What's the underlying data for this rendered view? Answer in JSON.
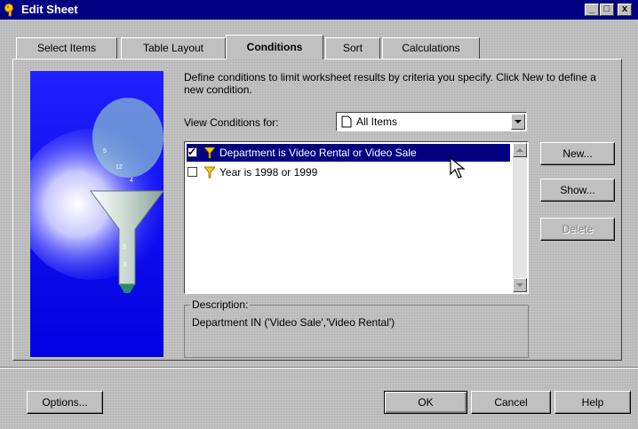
{
  "window": {
    "title": "Edit Sheet",
    "minimize": "_",
    "maximize": "□",
    "close": "x"
  },
  "tabs": [
    {
      "label": "Select Items"
    },
    {
      "label": "Table Layout"
    },
    {
      "label": "Conditions"
    },
    {
      "label": "Sort"
    },
    {
      "label": "Calculations"
    }
  ],
  "conditions": {
    "description": "Define conditions to limit worksheet results by criteria you specify. Click New to define a new condition.",
    "view_for_label": "View Conditions for:",
    "view_for_value": "All Items",
    "items": [
      {
        "checked": true,
        "text": "Department is Video Rental or Video Sale",
        "selected": true
      },
      {
        "checked": false,
        "text": "Year is 1998 or 1999",
        "selected": false
      }
    ],
    "description_box": {
      "legend": "Description:",
      "text": "Department IN ('Video Sale','Video Rental')"
    }
  },
  "side_buttons": {
    "new": "New...",
    "show": "Show...",
    "delete": "Delete"
  },
  "footer": {
    "options": "Options...",
    "ok": "OK",
    "cancel": "Cancel",
    "help": "Help"
  },
  "colors": {
    "titlebar": "#000080",
    "selection": "#000080",
    "illustration": "#1414ff"
  },
  "icons": {
    "app": "key-icon",
    "filter": "funnel-icon",
    "view": "page-icon"
  }
}
